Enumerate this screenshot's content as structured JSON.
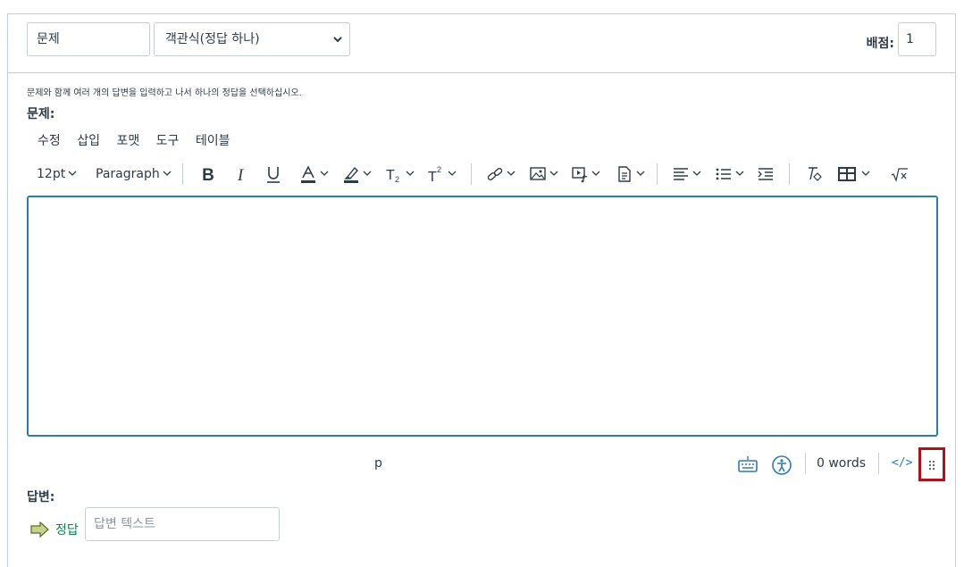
{
  "question": {
    "name_value": "문제",
    "type_value": "객관식(정답 하나)",
    "points_label": "배점:",
    "points_value": "1",
    "instructions": "문제와 함께 여러 개의 답변을 입력하고 나서 하나의 정답을 선택하십시오.",
    "question_label": "문제:"
  },
  "menubar": {
    "edit": "수정",
    "insert": "삽입",
    "format": "포맷",
    "tools": "도구",
    "table": "테이블"
  },
  "toolbar": {
    "font_size": "12pt",
    "block_format": "Paragraph",
    "icons": [
      "bold-icon",
      "italic-icon",
      "underline-icon",
      "text-color-icon",
      "highlight-icon",
      "subscript-icon",
      "superscript-icon",
      "link-icon",
      "image-icon",
      "media-icon",
      "document-icon",
      "align-icon",
      "list-icon",
      "indent-icon",
      "clear-format-icon",
      "table-icon",
      "equation-icon"
    ]
  },
  "status": {
    "path": "p",
    "words": "0 words",
    "html_toggle": "</>"
  },
  "answers": {
    "label": "답변:",
    "correct_label": "정답",
    "answer_placeholder": "답변 텍스트"
  },
  "colors": {
    "accent": "#2b7abc",
    "correct_green": "#0b874b",
    "highlight_box": "#b0121b"
  }
}
